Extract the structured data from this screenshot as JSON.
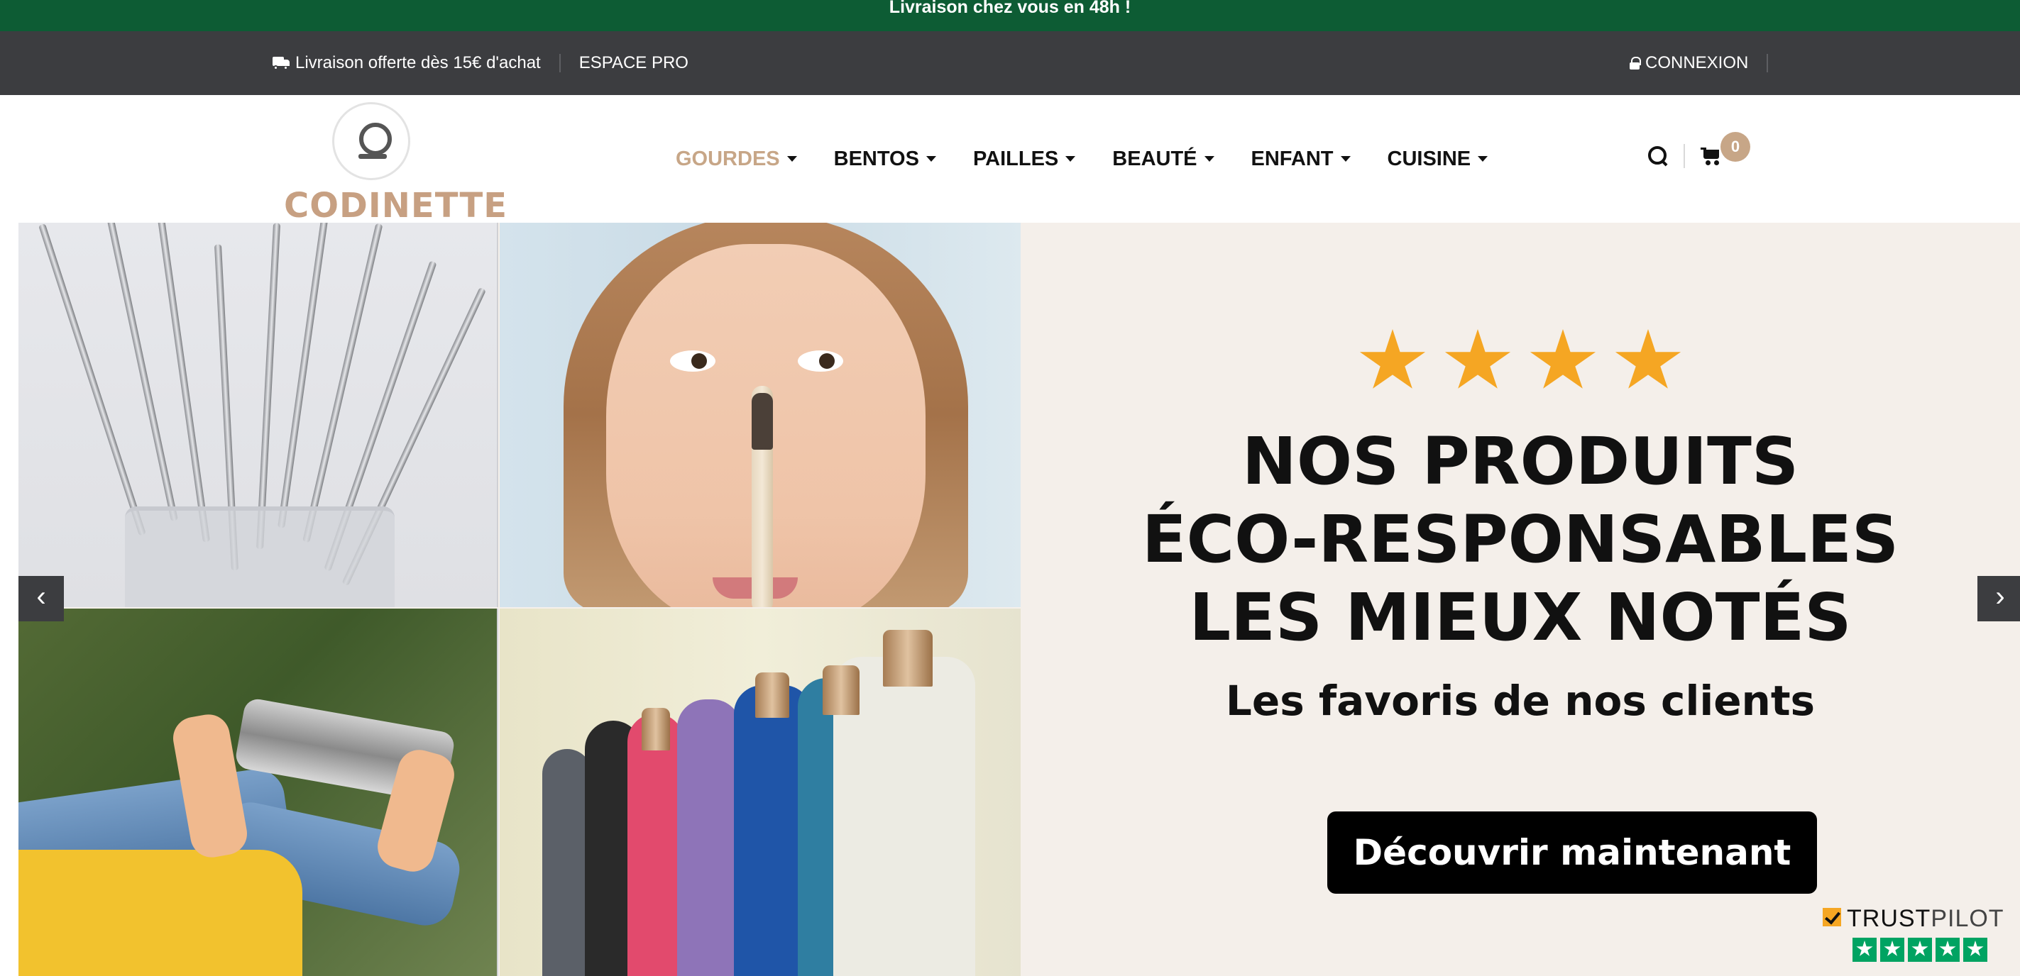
{
  "announcement": "Livraison chez vous en 48h !",
  "topbar": {
    "delivery_text": "Livraison offerte dès 15€ d'achat",
    "espace_pro": "ESPACE PRO",
    "connexion": "CONNEXION"
  },
  "header": {
    "logo_text": "CODINETTE",
    "nav": [
      {
        "label": "GOURDES",
        "active": true
      },
      {
        "label": "BENTOS",
        "active": false
      },
      {
        "label": "PAILLES",
        "active": false
      },
      {
        "label": "BEAUTÉ",
        "active": false
      },
      {
        "label": "ENFANT",
        "active": false
      },
      {
        "label": "CUISINE",
        "active": false
      }
    ],
    "cart_count": "0"
  },
  "hero": {
    "rating_stars": 4,
    "headline_line1": "NOS PRODUITS",
    "headline_line2": "ÉCO-RESPONSABLES",
    "headline_line3": "LES MIEUX NOTÉS",
    "subheadline": "Les favoris de nos clients",
    "cta_label": "Découvrir maintenant",
    "prev_arrow": "‹",
    "next_arrow": "›"
  },
  "trustpilot": {
    "label_trust": "TRUST",
    "label_pilot": "PILOT",
    "stars": 5
  },
  "colors": {
    "announcement_bg": "#0d5c34",
    "topbar_bg": "#3c3d40",
    "accent": "#c7a687",
    "star": "#f5a623",
    "trustpilot_green": "#00a362"
  }
}
